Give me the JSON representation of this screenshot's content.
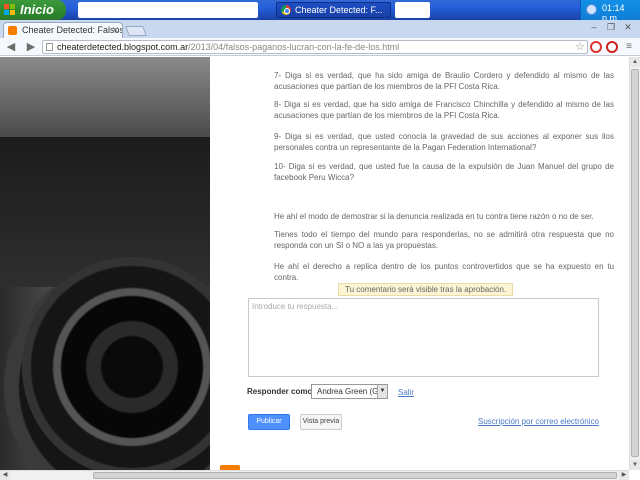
{
  "taskbar": {
    "start_label": "Inicio",
    "active_task": "Cheater Detected: F...",
    "clock": "01:14 p.m."
  },
  "browser": {
    "tab_title": "Cheater Detected: Falsos Pa",
    "url_host": "cheaterdetected.blogspot.com.ar",
    "url_path": "/2013/04/falsos-paganos-lucran-con-la-fe-de-los.html"
  },
  "post": {
    "paragraphs": [
      "7- Diga si es verdad, que ha sido amiga de Braulio Cordero y defendido al mismo de las acusaciones que partían de los miembros de la PFI Costa Rica.",
      "8- Diga si es verdad, que ha sido amiga de Francisco Chinchilla y defendido al mismo de las acusaciones que partían de los miembros de la PFI Costa Rica.",
      "9- Diga si es verdad, que usted conocía la gravedad de sus acciones al exponer sus ilos personales contra un representante de la Pagan Federation International?",
      "10- Diga si es verdad, que usted fue la causa de la expulsión de Juan Manuel del grupo de facebook Peru Wicca?",
      "He ahí el modo de demostrar si la denuncia realizada en tu contra tiene razón o no de ser.",
      "Tienes todo el tiempo del mundo para responderlas, no se admitirá otra respuesta que no responda con un SI o NO a las ya propuestas.",
      "He ahí el derecho a replica dentro de los puntos controvertidos que se ha expuesto en tu contra."
    ]
  },
  "comment_form": {
    "notice": "Tu comentario será visible tras la aprobación.",
    "placeholder": "Introduce tu respuesta...",
    "reply_as_label": "Responder como:",
    "reply_as_value": "Andrea Green (G",
    "logout_link": "Salir",
    "publish_button": "Publicar",
    "preview_button": "Vista previa",
    "subscribe_link": "Suscripción por correo electrónico"
  },
  "colors": {
    "taskbar_blue": "#245edb",
    "start_green": "#2f8a2f",
    "link_blue": "#4a79c8",
    "publish_blue": "#4d90fe",
    "notice_bg": "#fdf4d4"
  }
}
